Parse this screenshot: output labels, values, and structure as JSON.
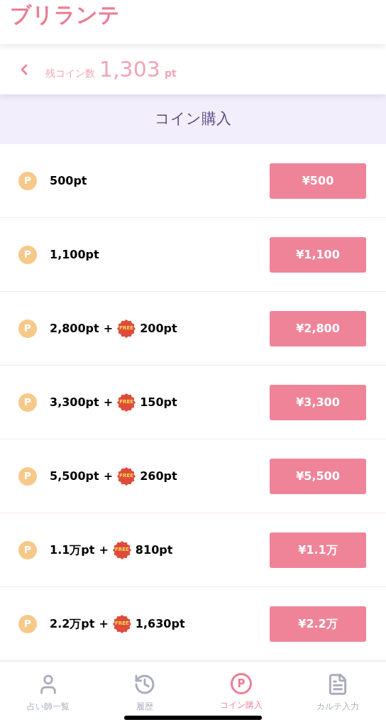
{
  "app": {
    "logo": "ブリランテ"
  },
  "balance": {
    "label": "残コイン数",
    "amount": "1,303",
    "unit": "pt"
  },
  "page_title": "コイン購入",
  "packages": [
    {
      "coin": "P",
      "points": "500pt",
      "price": "¥500"
    },
    {
      "coin": "P",
      "points": "1,100pt",
      "price": "¥1,100"
    },
    {
      "coin": "P",
      "points": "2,800pt",
      "plus": "+",
      "badge": "FREE",
      "bonus": "200pt",
      "price": "¥2,800"
    },
    {
      "coin": "P",
      "points": "3,300pt",
      "plus": "+",
      "badge": "FREE",
      "bonus": "150pt",
      "price": "¥3,300"
    },
    {
      "coin": "P",
      "points": "5,500pt",
      "plus": "+",
      "badge": "FREE",
      "bonus": "260pt",
      "price": "¥5,500"
    },
    {
      "coin": "P",
      "points": "1.1万pt",
      "plus": "+",
      "badge": "FREE",
      "bonus": "810pt",
      "price": "¥1.1万"
    },
    {
      "coin": "P",
      "points": "2.2万pt",
      "plus": "+",
      "badge": "FREE",
      "bonus": "1,630pt",
      "price": "¥2.2万"
    }
  ],
  "tabs": [
    {
      "kind": "person",
      "label": "占い師一覧",
      "selected": false
    },
    {
      "kind": "history",
      "label": "履歴",
      "selected": false
    },
    {
      "kind": "coin",
      "icon_text": "P",
      "label": "コイン購入",
      "selected": true
    },
    {
      "kind": "document",
      "label": "カルテ入力",
      "selected": false
    }
  ]
}
